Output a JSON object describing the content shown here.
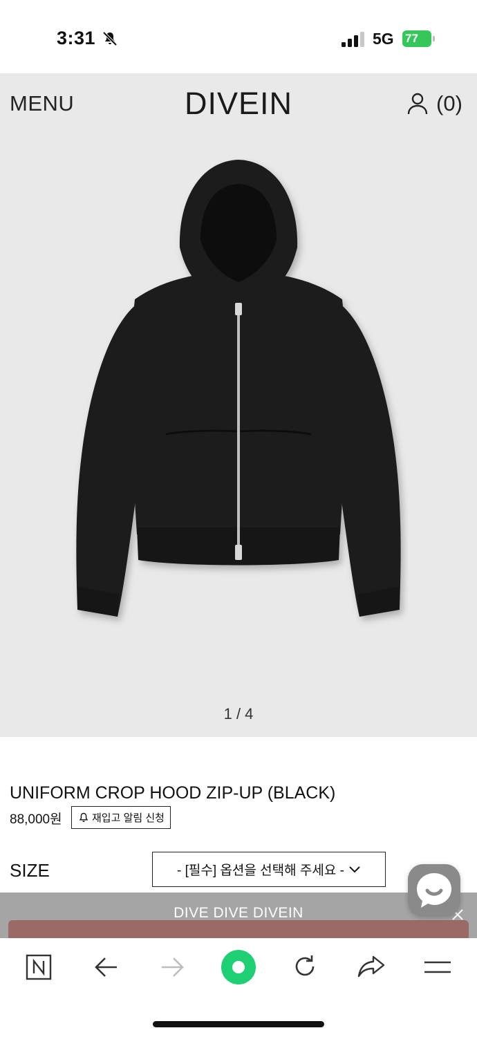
{
  "status_bar": {
    "time": "3:31",
    "network": "5G",
    "battery_level": "77",
    "battery_color": "#35c759",
    "icons": [
      "bell-slash-icon",
      "signal-bars-icon",
      "battery-charging-icon"
    ]
  },
  "header": {
    "menu_label": "MENU",
    "brand": "DIVEIN",
    "cart_count": "(0)",
    "icons": [
      "user-icon"
    ]
  },
  "gallery": {
    "pager": "1 / 4",
    "image": "black-zip-hoodie-photo",
    "background": "#e9e9e9"
  },
  "product": {
    "title": "UNIFORM CROP HOOD ZIP-UP (BLACK)",
    "price": "88,000원",
    "restock_label": "재입고 알림 신청"
  },
  "options": {
    "size_label": "SIZE",
    "size_placeholder": "- [필수] 옵션을 선택해 주세요 -"
  },
  "chat": {
    "icon": "chat-bubble-icon"
  },
  "promo": {
    "text": "DIVE DIVE DIVEIN",
    "strip_color": "#9b6a66"
  },
  "toolbar": {
    "icons": [
      "naver-n-icon",
      "back-arrow-icon",
      "forward-arrow-icon",
      "green-dot-icon",
      "reload-icon",
      "share-icon",
      "hamburger-icon"
    ],
    "accent": "#1fcf74"
  }
}
